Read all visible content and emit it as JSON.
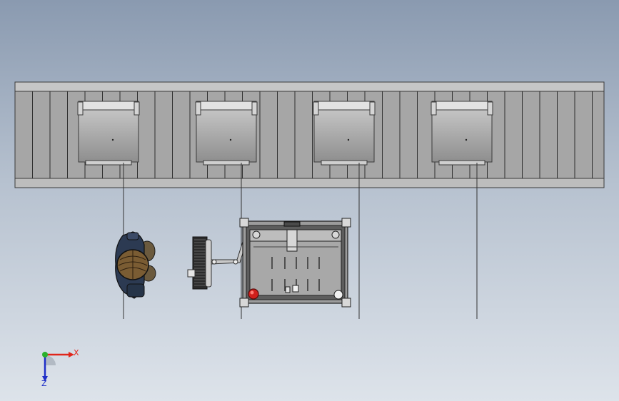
{
  "viewport": {
    "background_top": "#8a9ab0",
    "background_bottom": "#dde3ea",
    "stations": 4
  },
  "triad": {
    "x_label": "X",
    "z_label": "Z",
    "x_color": "#e0261b",
    "y_color": "#2bb12b",
    "z_color": "#1f2fc8"
  }
}
